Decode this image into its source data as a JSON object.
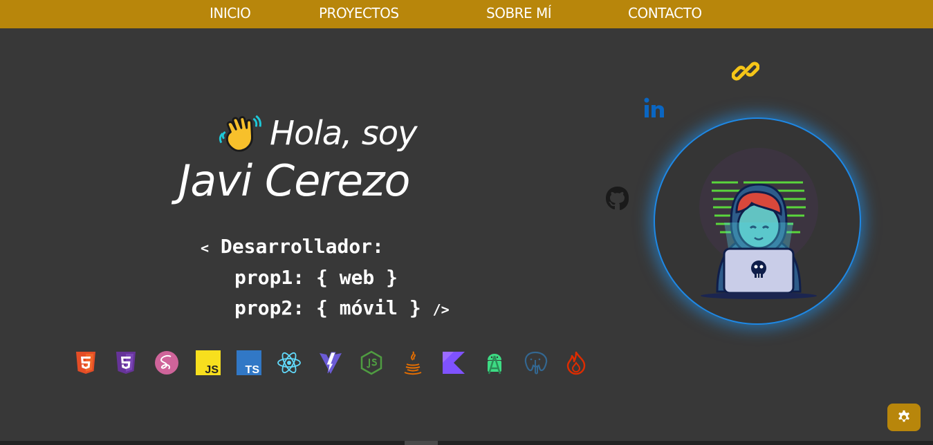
{
  "nav": {
    "items": [
      {
        "label": "INICIO"
      },
      {
        "label": "PROYECTOS"
      },
      {
        "label": "SOBRE MÍ"
      },
      {
        "label": "CONTACTO"
      }
    ]
  },
  "hero": {
    "greeting": "Hola, soy",
    "name": "Javi Cerezo",
    "code_line1_open": "<",
    "code_line1": "Desarrollador:",
    "code_line2": "prop1: { web }",
    "code_line3": "prop2: { móvil }",
    "code_line3_close": "/>"
  },
  "tech_icons": [
    "html5-icon",
    "css3-icon",
    "sass-icon",
    "javascript-icon",
    "typescript-icon",
    "react-icon",
    "vite-icon",
    "nodejs-icon",
    "java-icon",
    "kotlin-icon",
    "android-icon",
    "postgresql-icon",
    "firebase-icon"
  ],
  "tech_text": {
    "js": "JS",
    "ts": "TS"
  },
  "colors": {
    "nav_bg": "#b8860b",
    "page_bg": "#383838",
    "accent_blue": "#1e88e5",
    "link_yellow": "#f5c518",
    "linkedin_blue": "#0a66c2"
  }
}
